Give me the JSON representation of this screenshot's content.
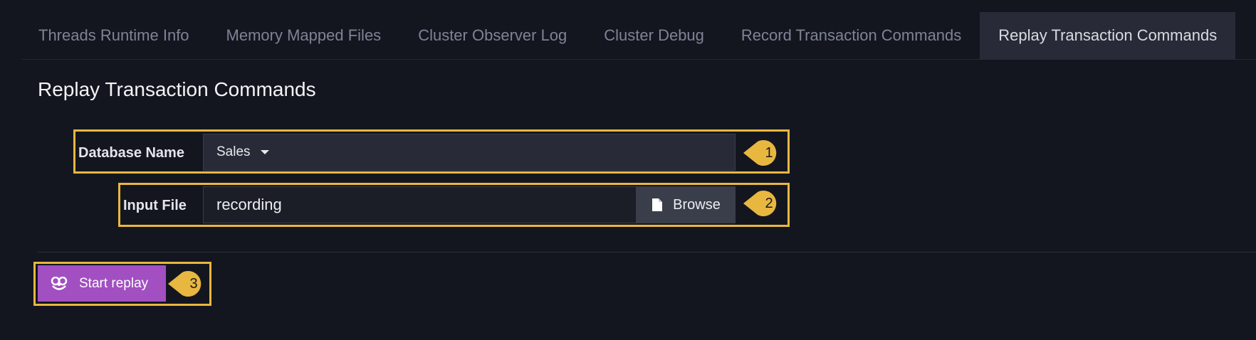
{
  "tabs": [
    {
      "label": "Threads Runtime Info",
      "active": false
    },
    {
      "label": "Memory Mapped Files",
      "active": false
    },
    {
      "label": "Cluster Observer Log",
      "active": false
    },
    {
      "label": "Cluster Debug",
      "active": false
    },
    {
      "label": "Record Transaction Commands",
      "active": false
    },
    {
      "label": "Replay Transaction Commands",
      "active": true
    }
  ],
  "page": {
    "title": "Replay Transaction Commands"
  },
  "form": {
    "database": {
      "label": "Database Name",
      "value": "Sales"
    },
    "input_file": {
      "label": "Input File",
      "value": "recording",
      "browse_label": "Browse"
    },
    "start_label": "Start replay"
  },
  "markers": [
    "1",
    "2",
    "3"
  ],
  "colors": {
    "background": "#14161f",
    "highlight": "#e8b740",
    "primary_button": "#a24fc1",
    "active_tab": "#282b37"
  }
}
